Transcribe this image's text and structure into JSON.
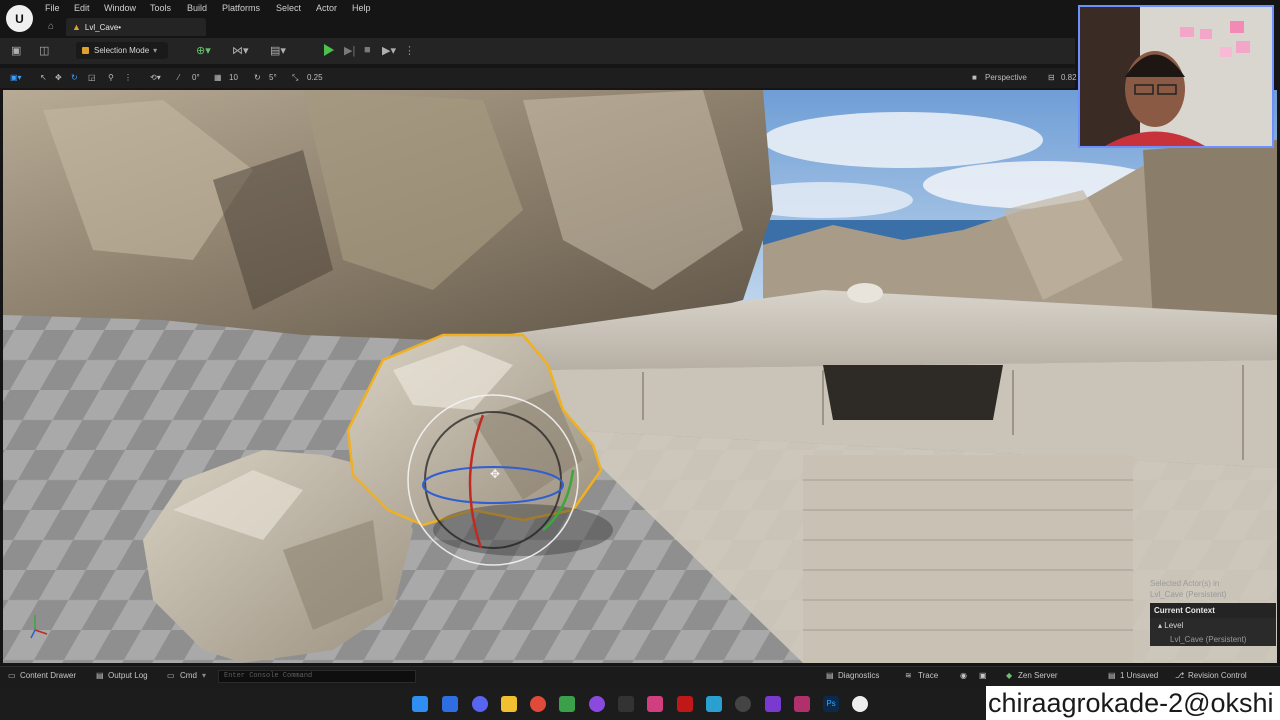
{
  "menu": {
    "items": [
      "File",
      "Edit",
      "Window",
      "Tools",
      "Build",
      "Platforms",
      "Select",
      "Actor",
      "Help"
    ],
    "level_tab": "Lvl_Cave•"
  },
  "toolbar": {
    "mode_label": "Selection Mode"
  },
  "viewport_toolbar": {
    "rotation_snap": "0°",
    "grid_snap": "10",
    "angle_snap": "5°",
    "scale_snap": "0.25",
    "view_mode": "Perspective",
    "speed": "0.82"
  },
  "context_panel": {
    "selected_line1": "Selected Actor(s) in",
    "selected_line2": "Lvl_Cave (Persistent)",
    "header": "Current Context",
    "level_label": "Level",
    "level_value": "Lvl_Cave (Persistent)"
  },
  "bottom_bar": {
    "content_drawer": "Content Drawer",
    "output_log": "Output Log",
    "cmd": "Cmd",
    "console_placeholder": "Enter Console Command",
    "diagnostics": "Diagnostics",
    "trace": "Trace",
    "zen_server": "Zen Server",
    "unsaved": "1 Unsaved",
    "revision_control": "Revision Control"
  },
  "watermark": "chiraagrokade-2@okshi",
  "colors": {
    "accent": "#e0a030",
    "play": "#4cc24c",
    "selection_outline": "#f0b020",
    "webcam_border": "#6f8fff"
  }
}
